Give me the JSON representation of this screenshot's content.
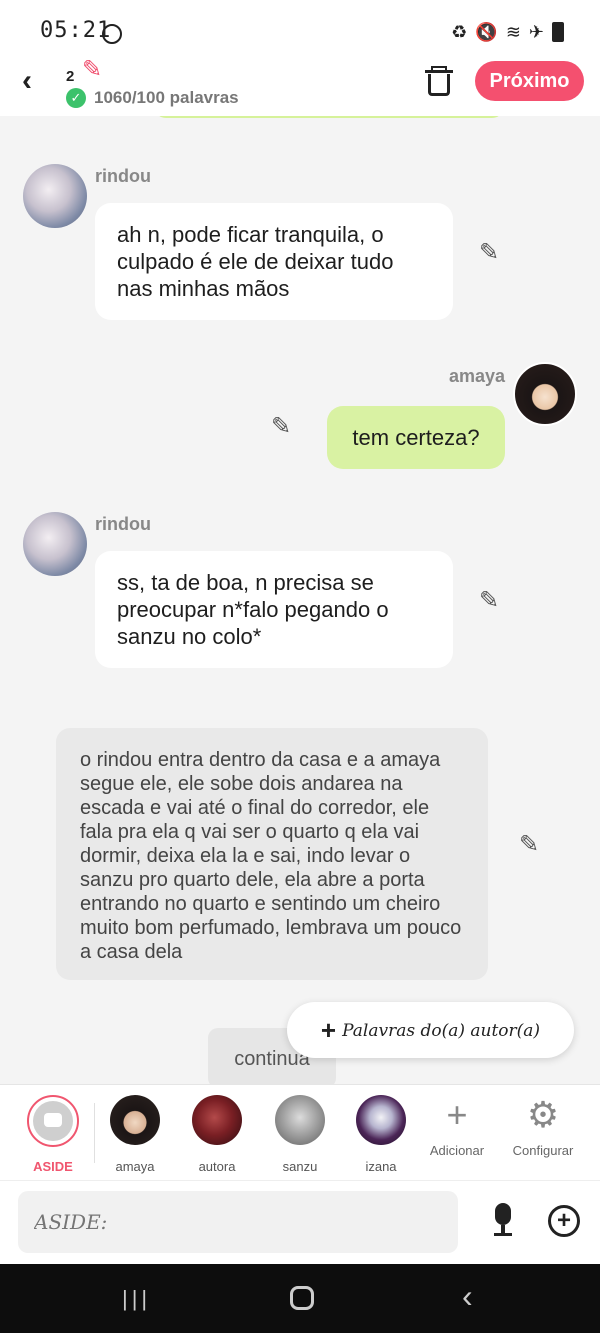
{
  "status": {
    "time": "05:21"
  },
  "header": {
    "chapter": "2",
    "word_count": "1060/100 palavras",
    "next_label": "Próximo"
  },
  "messages": [
    {
      "speaker": "rindou",
      "text": "ah n, pode ficar tranquila, o culpado é ele de deixar tudo nas minhas mãos"
    },
    {
      "speaker": "amaya",
      "text": "tem certeza?"
    },
    {
      "speaker": "rindou",
      "text": "ss, ta de boa, n precisa se preocupar n*falo pegando o sanzu no colo*"
    }
  ],
  "aside_text": "o rindou entra dentro da casa e a amaya segue ele, ele sobe dois andarea na escada e vai até o final do corredor, ele fala pra ela q vai ser o quarto q ela vai dormir, deixa ela la e sai, indo levar o sanzu pro quarto dele, ela abre a porta entrando no quarto e sentindo um cheiro muito bom perfumado, lembrava um pouco a casa dela",
  "continue_label": "continua",
  "author_words_label": "Palavras do(a) autor(a)",
  "characters": {
    "aside": "ASIDE",
    "list": [
      "amaya",
      "autora",
      "sanzu",
      "izana"
    ],
    "add_label": "Adicionar",
    "config_label": "Configurar"
  },
  "input": {
    "placeholder": "ASIDE:"
  },
  "colors": {
    "accent": "#f4506f",
    "green_bubble": "#d9f2a3",
    "check": "#3cc26b"
  }
}
